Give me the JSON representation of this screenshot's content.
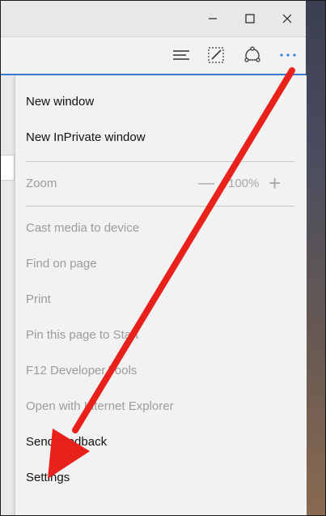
{
  "window": {
    "minimize_icon": "minimize-icon",
    "maximize_icon": "maximize-icon",
    "close_icon": "close-icon"
  },
  "toolbar": {
    "icons": [
      "hub-icon",
      "web-note-icon",
      "share-icon",
      "more-actions-icon"
    ],
    "accent": "#3a7bd5"
  },
  "menu": {
    "items": [
      {
        "label": "New window",
        "enabled": true
      },
      {
        "label": "New InPrivate window",
        "enabled": true
      },
      {
        "label": "Zoom",
        "enabled": false
      },
      {
        "label": "Cast media to device",
        "enabled": false
      },
      {
        "label": "Find on page",
        "enabled": false
      },
      {
        "label": "Print",
        "enabled": false
      },
      {
        "label": "Pin this page to Start",
        "enabled": false
      },
      {
        "label": "F12 Developer Tools",
        "enabled": false
      },
      {
        "label": "Open with Internet Explorer",
        "enabled": false
      },
      {
        "label": "Send feedback",
        "enabled": true
      },
      {
        "label": "Settings",
        "enabled": true
      }
    ],
    "zoom": {
      "minus": "—",
      "value": "100%",
      "plus": "+"
    }
  },
  "annotation": {
    "arrow_color": "#e8211b",
    "points_to": "Settings"
  }
}
